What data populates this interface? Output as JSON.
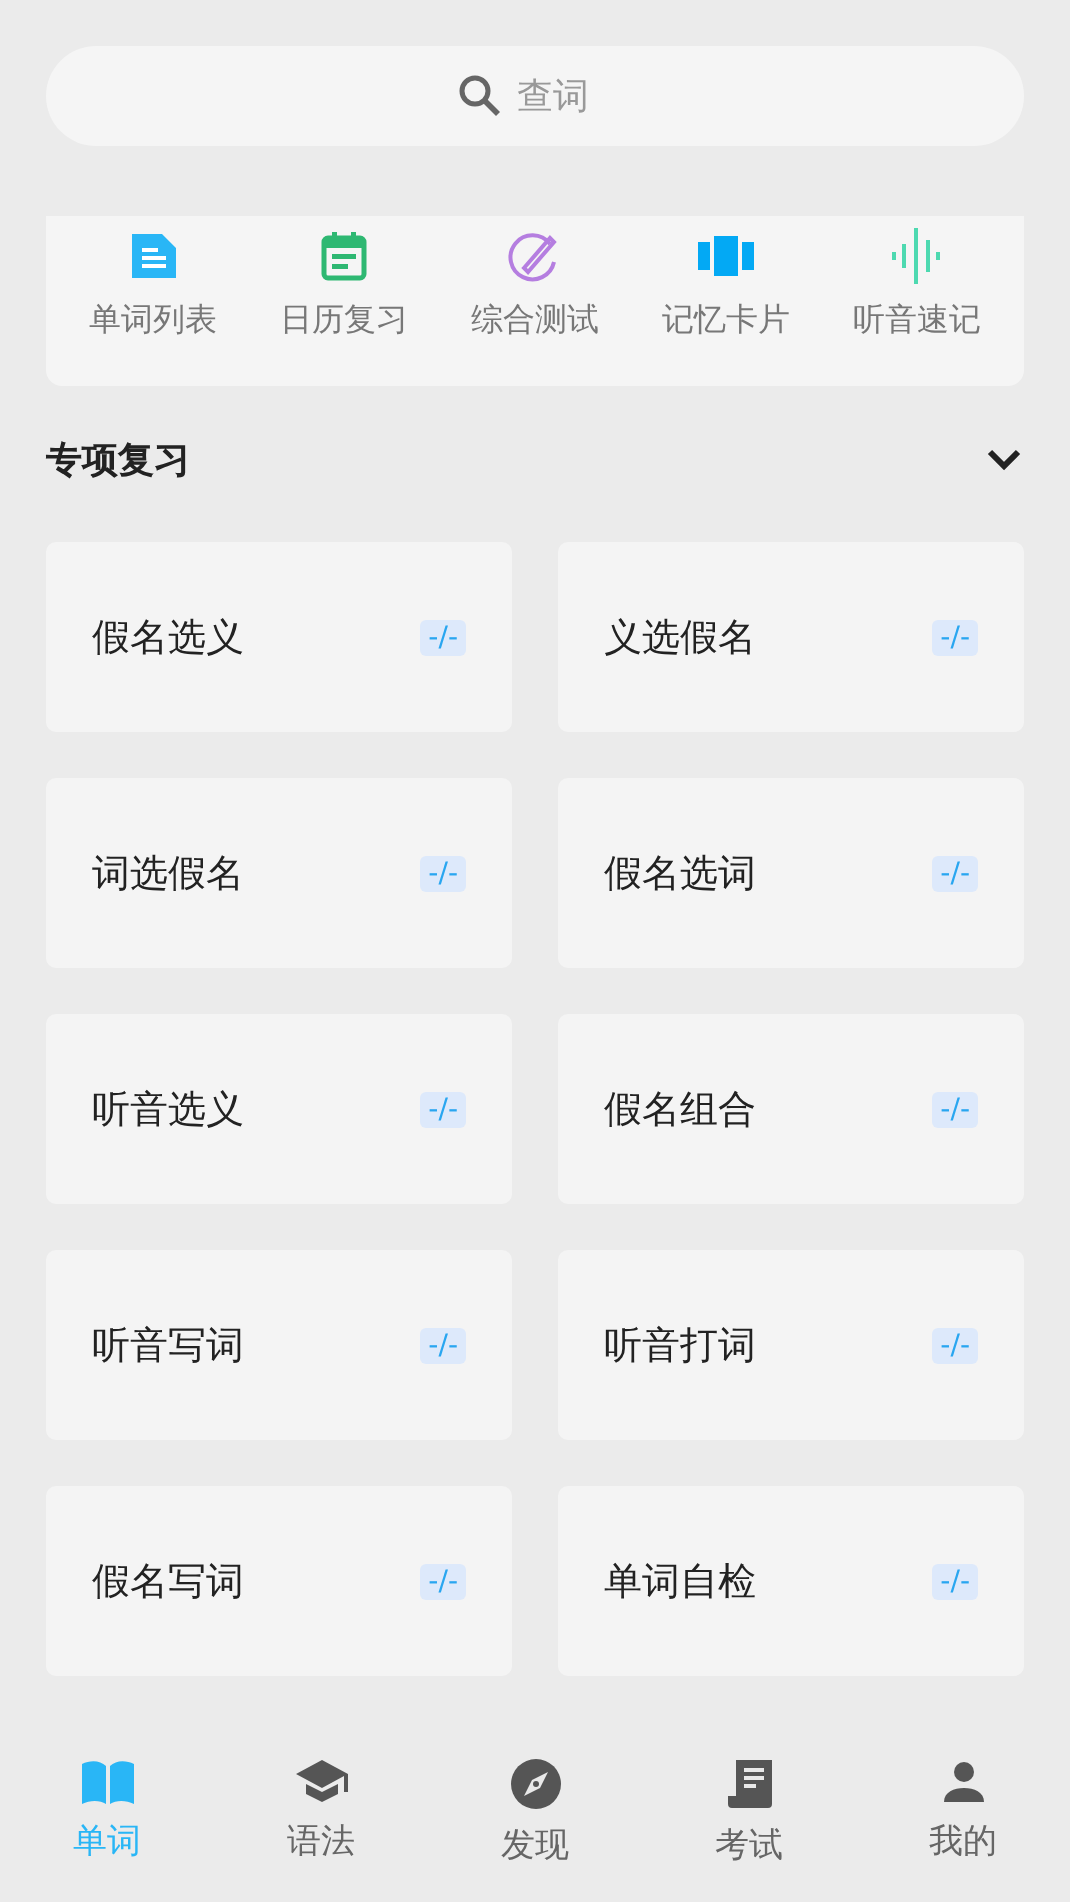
{
  "search": {
    "placeholder": "查词"
  },
  "shortcuts": [
    {
      "label": "单词列表",
      "kind": "doc",
      "color": "#29b6f6"
    },
    {
      "label": "日历复习",
      "kind": "calendar",
      "color": "#2eb872"
    },
    {
      "label": "综合测试",
      "kind": "pen",
      "color": "#b57ee0"
    },
    {
      "label": "记忆卡片",
      "kind": "cards",
      "color": "#03a9f4"
    },
    {
      "label": "听音速记",
      "kind": "wave",
      "color": "#4dd9b0"
    }
  ],
  "section": {
    "title": "专项复习",
    "expanded": true
  },
  "drills": [
    {
      "label": "假名选义",
      "score": "-/-"
    },
    {
      "label": "义选假名",
      "score": "-/-"
    },
    {
      "label": "词选假名",
      "score": "-/-"
    },
    {
      "label": "假名选词",
      "score": "-/-"
    },
    {
      "label": "听音选义",
      "score": "-/-"
    },
    {
      "label": "假名组合",
      "score": "-/-"
    },
    {
      "label": "听音写词",
      "score": "-/-"
    },
    {
      "label": "听音打词",
      "score": "-/-"
    },
    {
      "label": "假名写词",
      "score": "-/-"
    },
    {
      "label": "单词自检",
      "score": "-/-"
    }
  ],
  "nav": [
    {
      "label": "单词",
      "kind": "book",
      "selected": true
    },
    {
      "label": "语法",
      "kind": "cap",
      "selected": false
    },
    {
      "label": "发现",
      "kind": "compass",
      "selected": false
    },
    {
      "label": "考试",
      "kind": "paper",
      "selected": false
    },
    {
      "label": "我的",
      "kind": "person",
      "selected": false
    }
  ]
}
